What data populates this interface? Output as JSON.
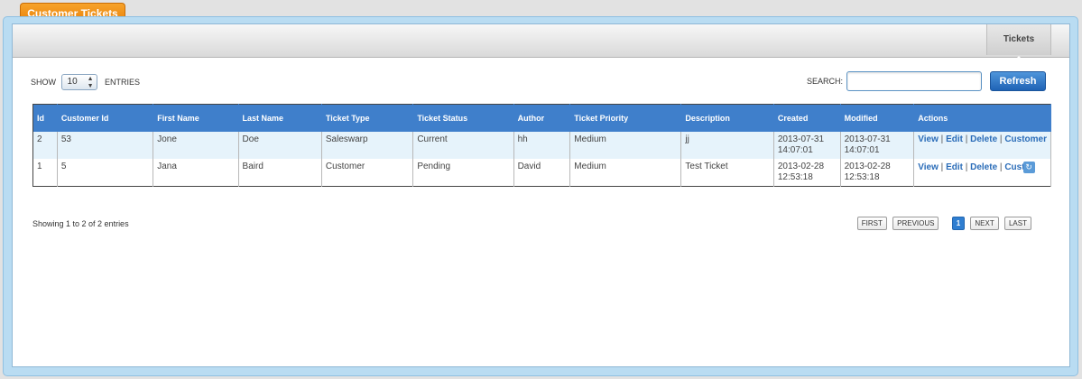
{
  "header": {
    "tab_label": "Customer Tickets"
  },
  "toolbar": {
    "active_tab": "Tickets"
  },
  "controls": {
    "show_label": "SHOW",
    "entries_value": "10",
    "entries_label": "ENTRIES",
    "search_label": "SEARCH:",
    "search_value": "",
    "refresh_label": "Refresh"
  },
  "table": {
    "columns": [
      "Id",
      "Customer Id",
      "First Name",
      "Last Name",
      "Ticket Type",
      "Ticket Status",
      "Author",
      "Ticket Priority",
      "Description",
      "Created",
      "Modified",
      "Actions"
    ],
    "rows": [
      {
        "id": "2",
        "customer_id": "53",
        "first_name": "Jone",
        "last_name": "Doe",
        "ticket_type": "Saleswarp",
        "ticket_status": "Current",
        "author": "hh",
        "priority": "Medium",
        "description": "jj",
        "created": "2013-07-31 14:07:01",
        "modified": "2013-07-31 14:07:01",
        "actions": [
          "View",
          "Edit",
          "Delete",
          "Customer"
        ]
      },
      {
        "id": "1",
        "customer_id": "5",
        "first_name": "Jana",
        "last_name": "Baird",
        "ticket_type": "Customer",
        "ticket_status": "Pending",
        "author": "David",
        "priority": "Medium",
        "description": "Test Ticket",
        "created": "2013-02-28 12:53:18",
        "modified": "2013-02-28 12:53:18",
        "actions": [
          "View",
          "Edit",
          "Delete",
          "Custo"
        ]
      }
    ]
  },
  "footer": {
    "info": "Showing 1 to 2 of 2 entries",
    "pager": {
      "first": "FIRST",
      "previous": "PREVIOUS",
      "current": "1",
      "next": "NEXT",
      "last": "LAST"
    }
  },
  "colors": {
    "accent_orange": "#ee8c12",
    "header_blue": "#3f7fcb",
    "link_blue": "#2a6cb8"
  },
  "icons": {
    "scroll_top": "scroll-top-icon"
  }
}
